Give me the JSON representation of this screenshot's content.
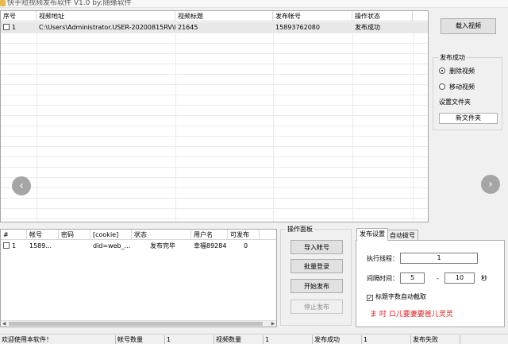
{
  "window": {
    "title": "快手短视频发布软件 V1.0 by:随缘软件"
  },
  "video_list": {
    "columns": [
      "序号",
      "视频地址",
      "视频标题",
      "发布帐号",
      "操作状态"
    ],
    "rows": [
      {
        "index": "1",
        "path": "C:\\Users\\Administrator.USER-20200815RV\\D...",
        "title": "21645",
        "account": "15893762080",
        "status": "发布成功"
      }
    ]
  },
  "right_panel": {
    "load_button": "载入视频",
    "group_label": "发布成功",
    "radio_delete": "删除视频",
    "radio_move": "移动视频",
    "radio_selected": "删除视频",
    "folder_label": "设置文件夹",
    "folder_button": "新文件夹"
  },
  "account_list": {
    "columns": [
      "#",
      "帐号",
      "密码",
      "[cookie]",
      "状态",
      "用户名",
      "可发布"
    ],
    "rows": [
      {
        "index": "1",
        "account": "1589...",
        "password": "",
        "cookie": "did=web_...",
        "status": "发布完毕",
        "username": "幸福89284",
        "publishable": "0"
      }
    ]
  },
  "operation_panel": {
    "group_label": "操作面板",
    "import_button": "导入帐号",
    "batch_login_button": "批量登录",
    "start_button": "开始发布",
    "stop_button": "停止发布"
  },
  "settings": {
    "tabs": [
      "发布设置",
      "自动拨号"
    ],
    "active_tab": "发布设置",
    "threads_label": "执行线程：",
    "threads_value": "1",
    "interval_label": "间隔时间：",
    "interval_min": "5",
    "interval_sep": "-",
    "interval_max": "10",
    "interval_unit": "秒",
    "checkbox_label": "标题字数自动截取",
    "checkbox_checked": true,
    "footer_text": "ま 吋 ロ儿要妻要爸儿灵灵",
    "footer_color": "#e0161b"
  },
  "statusbar": {
    "welcome": "欢迎使用本软件！",
    "account_count_label": "帐号数量",
    "account_count": "1",
    "video_count_label": "视频数量",
    "video_count": "1",
    "publish_success_label": "发布成功",
    "publish_success": "1",
    "publish_fail_label": "发布失败",
    "publish_fail": ""
  },
  "icons": {
    "prev": "chevron-left-icon",
    "next": "chevron-right-icon"
  }
}
